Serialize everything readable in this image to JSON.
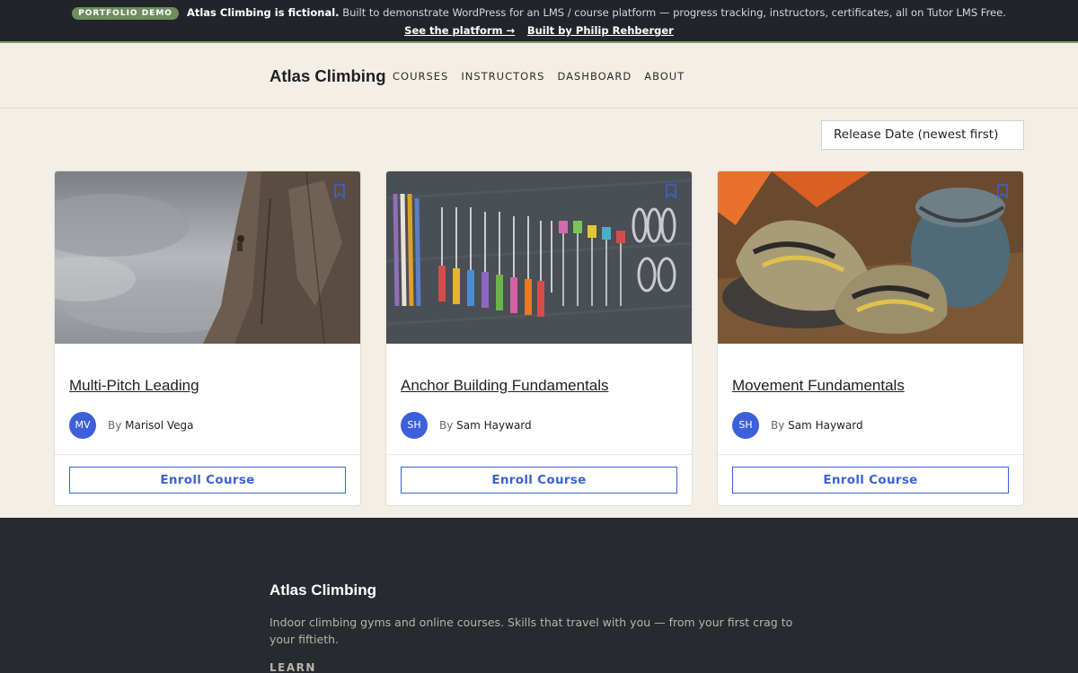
{
  "banner": {
    "badge": "PORTFOLIO DEMO",
    "headline": "Atlas Climbing is fictional.",
    "description": "Built to demonstrate WordPress for an LMS / course platform — progress tracking, instructors, certificates, all on Tutor LMS Free.",
    "link_platform": "See the platform →",
    "link_builder": "Built by Philip Rehberger"
  },
  "header": {
    "brand": "Atlas Climbing",
    "nav": [
      "COURSES",
      "INSTRUCTORS",
      "DASHBOARD",
      "ABOUT"
    ]
  },
  "sort": {
    "selected": "Release Date (newest first)"
  },
  "courses": [
    {
      "title": "Multi-Pitch Leading",
      "initials": "MV",
      "by": "By",
      "instructor": "Marisol Vega",
      "enroll_label": "Enroll Course",
      "image_icon": "rock-face-climber-photo"
    },
    {
      "title": "Anchor Building Fundamentals",
      "initials": "SH",
      "by": "By",
      "instructor": "Sam Hayward",
      "enroll_label": "Enroll Course",
      "image_icon": "climbing-gear-rack-photo"
    },
    {
      "title": "Movement Fundamentals",
      "initials": "SH",
      "by": "By",
      "instructor": "Sam Hayward",
      "enroll_label": "Enroll Course",
      "image_icon": "climbing-shoes-chalk-bag-photo"
    }
  ],
  "footer": {
    "brand": "Atlas Climbing",
    "description": "Indoor climbing gyms and online courses. Skills that travel with you — from your first crag to your fiftieth.",
    "heading": "LEARN"
  },
  "colors": {
    "accent": "#3a62d6",
    "avatar": "#3d5fd9",
    "banner_bg": "#212428",
    "page_bg": "#f4efe6",
    "footer_bg": "#272a2f",
    "badge": "#6f8d5e"
  }
}
